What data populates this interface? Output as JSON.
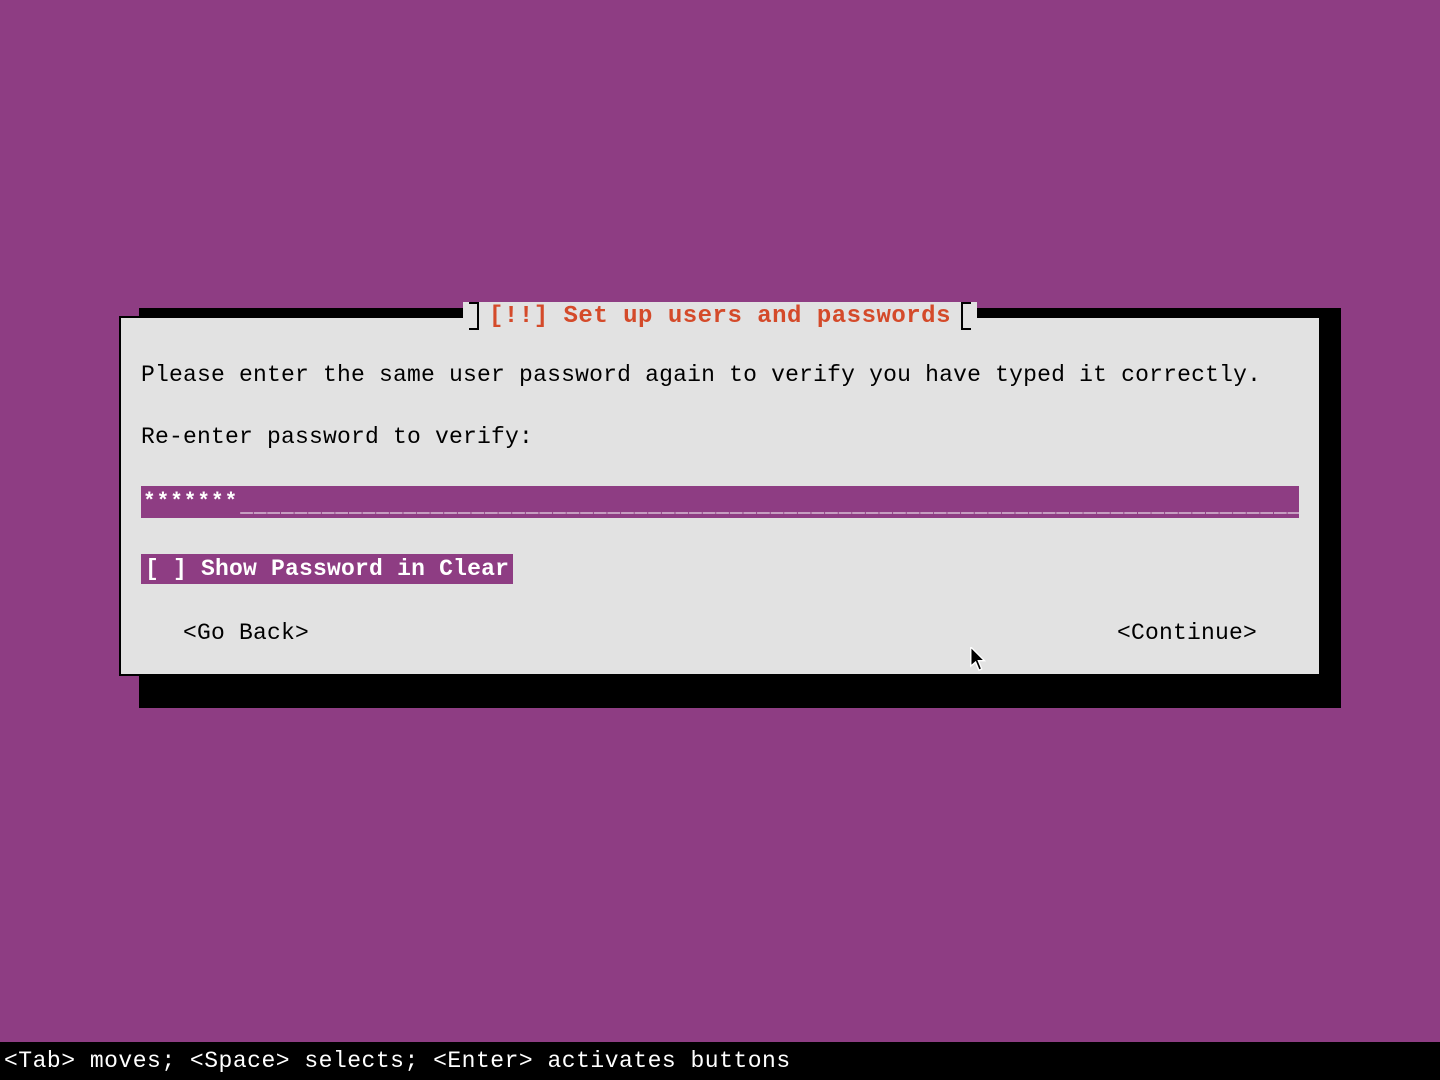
{
  "colors": {
    "bg": "#8e3d83",
    "dialog_bg": "#e2e2e2",
    "title": "#d44a2a",
    "highlight_bg": "#8e3d83",
    "highlight_fg": "#ffffff"
  },
  "dialog": {
    "title": "[!!] Set up users and passwords",
    "instruction": "Please enter the same user password again to verify you have typed it correctly.",
    "field_label": "Re-enter password to verify:",
    "password_masked": "*******",
    "password_fill": "________________________________________________________________________________",
    "checkbox": {
      "state": "[ ]",
      "label": "Show Password in Clear"
    },
    "buttons": {
      "back": "<Go Back>",
      "continue": "<Continue>"
    }
  },
  "statusbar": "<Tab> moves; <Space> selects; <Enter> activates buttons"
}
